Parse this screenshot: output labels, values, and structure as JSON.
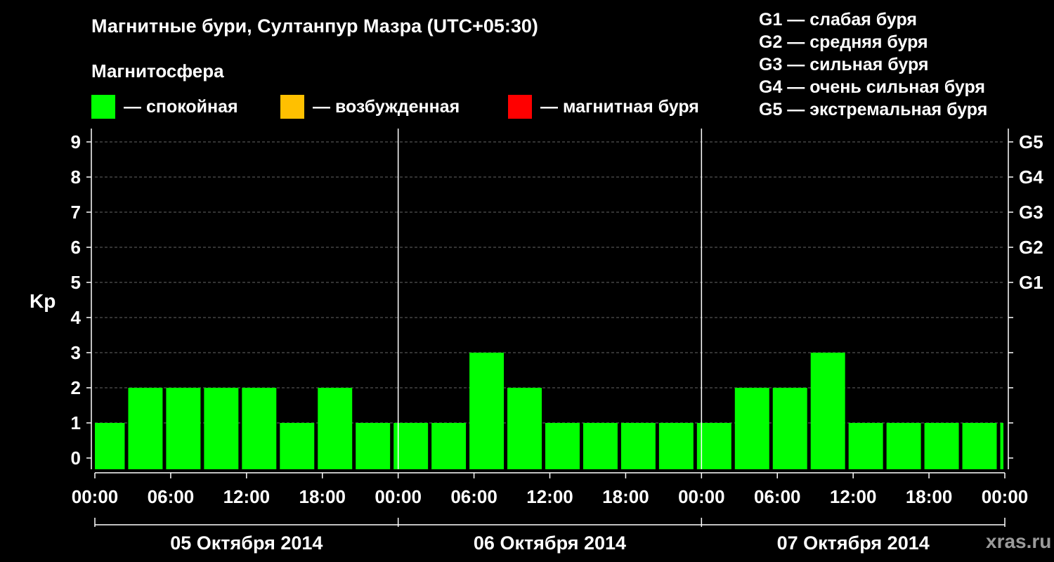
{
  "chart_data": {
    "type": "bar",
    "title": "Магнитные бури, Султанпур Мазра (UTC+05:30)",
    "ylabel": "Kp",
    "ylim": [
      0,
      9
    ],
    "yticks": [
      "0",
      "1",
      "2",
      "3",
      "4",
      "5",
      "6",
      "7",
      "8",
      "9"
    ],
    "right_ticks": [
      {
        "value": 5,
        "label": "G1"
      },
      {
        "value": 6,
        "label": "G2"
      },
      {
        "value": 7,
        "label": "G3"
      },
      {
        "value": 8,
        "label": "G4"
      },
      {
        "value": 9,
        "label": "G5"
      }
    ],
    "xticks": [
      "00:00",
      "06:00",
      "12:00",
      "18:00",
      "00:00",
      "06:00",
      "12:00",
      "18:00",
      "00:00",
      "06:00",
      "12:00",
      "18:00",
      "00:00"
    ],
    "days": [
      "05 Октября 2014",
      "06 Октября 2014",
      "07 Октября 2014"
    ],
    "x": [
      "00:00–02:30",
      "02:30–05:30",
      "05:30–08:30",
      "08:30–11:30",
      "11:30–14:30",
      "14:30–17:30",
      "17:30–20:30",
      "20:30–23:30",
      "23:30–02:30",
      "02:30–05:30",
      "05:30–08:30",
      "08:30–11:30",
      "11:30–14:30",
      "14:30–17:30",
      "17:30–20:30",
      "20:30–23:30",
      "23:30–02:30",
      "02:30–05:30",
      "05:30–08:30",
      "08:30–11:30",
      "11:30–14:30",
      "14:30–17:30",
      "17:30–20:30",
      "20:30–23:30",
      "23:30–00:00"
    ],
    "values": [
      1,
      2,
      2,
      2,
      2,
      1,
      2,
      1,
      1,
      1,
      3,
      2,
      1,
      1,
      1,
      1,
      1,
      2,
      2,
      3,
      1,
      1,
      1,
      1,
      1
    ],
    "bar_color": "#00ff00",
    "grid": true
  },
  "magnetosphere": {
    "label": "Магнитосфера",
    "states": [
      {
        "label": "— спокойная",
        "color": "#00ff00"
      },
      {
        "label": "— возбужденная",
        "color": "#ffc000"
      },
      {
        "label": "— магнитная буря",
        "color": "#ff0000"
      }
    ]
  },
  "storm_levels": [
    "G1 — слабая буря",
    "G2 — средняя буря",
    "G3 — сильная буря",
    "G4 — очень сильная буря",
    "G5 — экстремальная буря"
  ],
  "watermark": "xras.ru"
}
